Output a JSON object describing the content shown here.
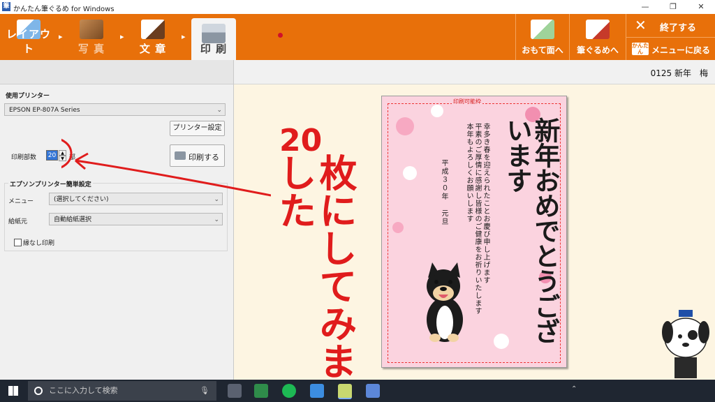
{
  "window": {
    "title": "かんたん筆ぐるめ for Windows",
    "app_icon": "筆",
    "minimize": "—",
    "maximize": "❐",
    "close": "✕"
  },
  "steps": [
    {
      "label": "レイアウト",
      "icon": "layout-icon",
      "active": false
    },
    {
      "label": "写 真",
      "icon": "photo-icon",
      "active": false
    },
    {
      "label": "文 章",
      "icon": "text-icon",
      "active": false
    },
    {
      "label": "印 刷",
      "icon": "printer-icon",
      "active": true
    }
  ],
  "right_buttons": {
    "omote": "おもて面へ",
    "fudegurume": "筆ぐるめへ",
    "exit": "終了する",
    "exit_icon": "✕",
    "menu_back": "メニューに戻る",
    "menu_badge": "かんたん"
  },
  "left_panel": {
    "printer_label": "使用プリンター",
    "printer_value": "EPSON EP-807A Series",
    "printer_settings_btn": "プリンター設定",
    "copies_label": "印刷部数",
    "copies_value": "20",
    "copies_unit": "部",
    "print_btn": "印刷する",
    "group_title": "エプソンプリンター簡単設定",
    "menu_label": "メニュー",
    "menu_value": "(選択してください)",
    "paper_label": "給紙元",
    "paper_value": "自動給紙選択",
    "borderless_label": "縁なし印刷"
  },
  "document": {
    "name": "0125 新年　梅"
  },
  "card": {
    "frame_label": "印刷可能枠",
    "greeting": "新年おめでとうございます",
    "body": "幸多き春を迎えられたことお慶び申し上げます\n平素のご厚情に感謝し皆様のご健康をお祈りいたします\n本年もよろしくお願いします",
    "date": "平成３０年　元旦"
  },
  "annotation": {
    "number": "20",
    "text": "枚にしてみました"
  },
  "taskbar": {
    "search_placeholder": "ここに入力して検索"
  },
  "colors": {
    "toolbar": "#e8700a",
    "card_bg": "#fbd3df",
    "annotation": "#e01c1c",
    "canvas": "#fdf5e2"
  }
}
